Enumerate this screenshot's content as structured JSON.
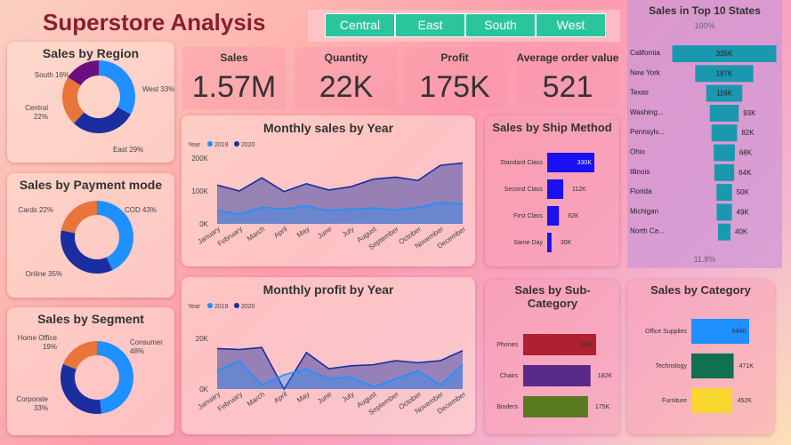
{
  "title": "Superstore Analysis",
  "filters": [
    "Central",
    "East",
    "South",
    "West"
  ],
  "kpis": [
    {
      "label": "Sales",
      "value": "1.57M"
    },
    {
      "label": "Quantity",
      "value": "22K"
    },
    {
      "label": "Profit",
      "value": "175K"
    },
    {
      "label": "Average order value",
      "value": "521"
    }
  ],
  "region": {
    "title": "Sales by Region",
    "labels": [
      "West 33%",
      "East 29%",
      "Central\n22%",
      "South 16%"
    ]
  },
  "payment": {
    "title": "Sales by Payment mode",
    "labels": [
      "COD 43%",
      "Online 35%",
      "Cards 22%"
    ]
  },
  "segment": {
    "title": "Sales by Segment",
    "labels": [
      "Consumer\n48%",
      "Corporate\n33%",
      "Home Office\n19%"
    ]
  },
  "monthly_sales": {
    "title": "Monthly sales by Year",
    "legend_title": "Year",
    "y_ticks": [
      "200K",
      "100K",
      "0K"
    ]
  },
  "monthly_profit": {
    "title": "Monthly profit by Year",
    "legend_title": "Year",
    "y_ticks": [
      "20K",
      "0K"
    ]
  },
  "ship": {
    "title": "Sales by Ship Method"
  },
  "subcat": {
    "title": "Sales by Sub-Category"
  },
  "category": {
    "title": "Sales by Category"
  },
  "states": {
    "title": "Sales in Top 10 States",
    "top_pct": "100%",
    "bottom_pct": "11.8%"
  },
  "chart_data": [
    {
      "id": "region",
      "type": "pie",
      "title": "Sales by Region",
      "categories": [
        "West",
        "East",
        "Central",
        "South"
      ],
      "values": [
        33,
        29,
        22,
        16
      ],
      "colors": [
        "#1e90ff",
        "#1a2ea0",
        "#e8763a",
        "#6a0f80"
      ]
    },
    {
      "id": "payment",
      "type": "pie",
      "title": "Sales by Payment mode",
      "categories": [
        "COD",
        "Online",
        "Cards"
      ],
      "values": [
        43,
        35,
        22
      ],
      "colors": [
        "#1e90ff",
        "#1a2ea0",
        "#e8763a"
      ]
    },
    {
      "id": "segment",
      "type": "pie",
      "title": "Sales by Segment",
      "categories": [
        "Consumer",
        "Corporate",
        "Home Office"
      ],
      "values": [
        48,
        33,
        19
      ],
      "colors": [
        "#1e90ff",
        "#1a2ea0",
        "#e8763a"
      ]
    },
    {
      "id": "msales",
      "type": "area",
      "title": "Monthly sales by Year",
      "categories": [
        "January",
        "February",
        "March",
        "April",
        "May",
        "June",
        "July",
        "August",
        "September",
        "October",
        "November",
        "December"
      ],
      "ylim": [
        0,
        200000
      ],
      "series": [
        {
          "name": "2019",
          "color": "#1e90ff",
          "values": [
            40000,
            30000,
            50000,
            45000,
            55000,
            40000,
            45000,
            48000,
            42000,
            50000,
            65000,
            60000
          ]
        },
        {
          "name": "2020",
          "color": "#1a2ea0",
          "values": [
            118000,
            100000,
            140000,
            98000,
            122000,
            103000,
            113000,
            136000,
            142000,
            132000,
            178000,
            185000
          ]
        }
      ]
    },
    {
      "id": "mprofit",
      "type": "area",
      "title": "Monthly profit by Year",
      "categories": [
        "January",
        "February",
        "March",
        "April",
        "May",
        "June",
        "July",
        "August",
        "September",
        "October",
        "November",
        "December"
      ],
      "ylim": [
        0,
        25000
      ],
      "series": [
        {
          "name": "2019",
          "color": "#1e90ff",
          "values": [
            9000,
            14000,
            2000,
            7000,
            10000,
            5000,
            6000,
            1000,
            5000,
            9000,
            2000,
            12000
          ]
        },
        {
          "name": "2020",
          "color": "#1a2ea0",
          "values": [
            20000,
            19500,
            20500,
            0,
            18000,
            10000,
            11500,
            12000,
            14000,
            13000,
            14000,
            19000
          ]
        }
      ]
    },
    {
      "id": "ship",
      "type": "bar",
      "title": "Sales by Ship Method",
      "categories": [
        "Standard Class",
        "Second Class",
        "First Class",
        "Same Day"
      ],
      "values": [
        330000,
        112000,
        82000,
        30000
      ],
      "labels": [
        "330K",
        "112K",
        "82K",
        "30K"
      ],
      "color": "#1a10f0"
    },
    {
      "id": "subcat",
      "type": "bar",
      "title": "Sales by Sub-Category",
      "categories": [
        "Phones",
        "Chairs",
        "Binders"
      ],
      "values": [
        197000,
        182000,
        175000
      ],
      "labels": [
        "197K",
        "182K",
        "175K"
      ],
      "colors": [
        "#b02030",
        "#5a2a8a",
        "#5a7a20"
      ]
    },
    {
      "id": "category",
      "type": "bar",
      "title": "Sales by Category",
      "categories": [
        "Office Supplies",
        "Technology",
        "Furniture"
      ],
      "values": [
        644000,
        471000,
        452000
      ],
      "labels": [
        "644K",
        "471K",
        "452K"
      ],
      "colors": [
        "#1e90ff",
        "#107050",
        "#f8d830"
      ]
    },
    {
      "id": "states",
      "type": "bar",
      "title": "Sales in Top 10 States",
      "categories": [
        "California",
        "New York",
        "Texas",
        "Washing...",
        "Pennsylv...",
        "Ohio",
        "Illinois",
        "Florida",
        "Michigan",
        "North Ca..."
      ],
      "values": [
        335000,
        187000,
        116000,
        93000,
        82000,
        68000,
        64000,
        50000,
        49000,
        40000
      ],
      "labels": [
        "335K",
        "187K",
        "116K",
        "93K",
        "82K",
        "68K",
        "64K",
        "50K",
        "49K",
        "40K"
      ],
      "color": "#1a98b0"
    }
  ]
}
